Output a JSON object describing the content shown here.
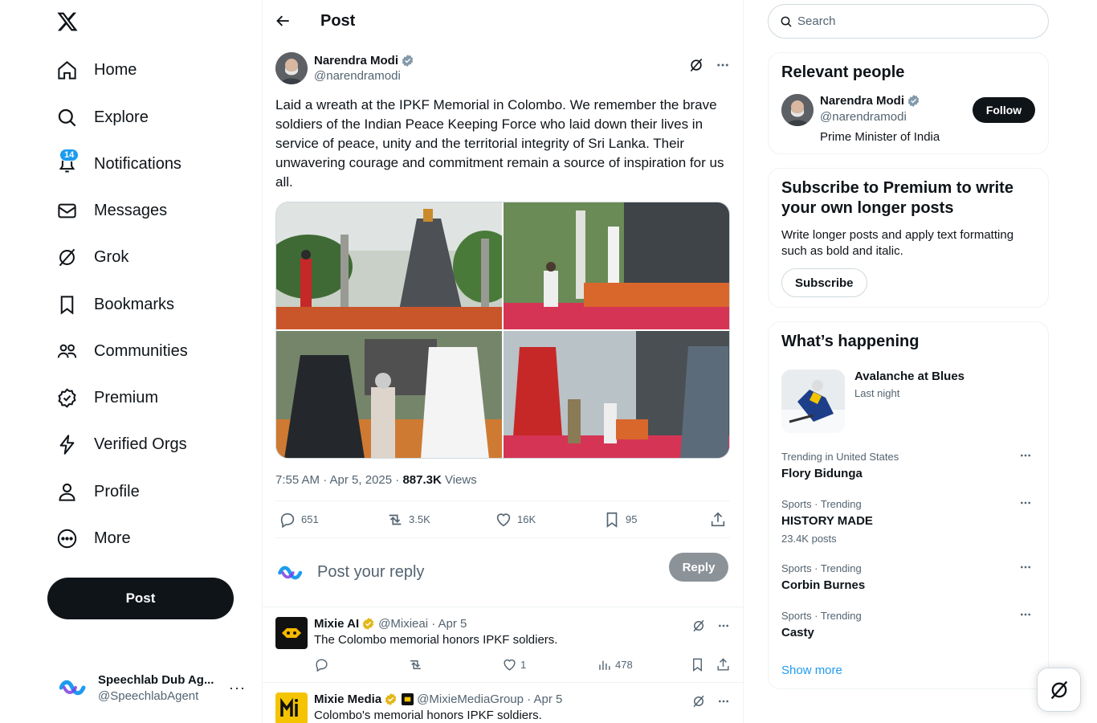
{
  "nav": {
    "items": [
      {
        "label": "Home",
        "icon": "home-icon"
      },
      {
        "label": "Explore",
        "icon": "search-icon"
      },
      {
        "label": "Notifications",
        "icon": "bell-icon",
        "badge": "14"
      },
      {
        "label": "Messages",
        "icon": "mail-icon"
      },
      {
        "label": "Grok",
        "icon": "grok-icon"
      },
      {
        "label": "Bookmarks",
        "icon": "bookmark-icon"
      },
      {
        "label": "Communities",
        "icon": "communities-icon"
      },
      {
        "label": "Premium",
        "icon": "premium-icon"
      },
      {
        "label": "Verified Orgs",
        "icon": "lightning-icon"
      },
      {
        "label": "Profile",
        "icon": "person-icon"
      },
      {
        "label": "More",
        "icon": "more-circle-icon"
      }
    ],
    "post_label": "Post",
    "account": {
      "name": "Speechlab Dub Ag...",
      "handle": "@SpeechlabAgent",
      "more": "···"
    }
  },
  "header": {
    "title": "Post"
  },
  "tweet": {
    "author": "Narendra Modi",
    "handle": "@narendramodi",
    "text": "Laid a wreath at the IPKF Memorial in Colombo. We remember the brave soldiers of the Indian Peace Keeping Force who laid down their lives in service of peace, unity and the territorial integrity of Sri Lanka. Their unwavering courage and commitment remain a source of inspiration for us all.",
    "time": "7:55 AM · Apr 5, 2025 · ",
    "views_count": "887.3K",
    "views_label": " Views",
    "replies": "651",
    "reposts": "3.5K",
    "likes": "16K",
    "bookmarks": "95"
  },
  "reply_box": {
    "placeholder": "Post your reply",
    "button": "Reply"
  },
  "replies": [
    {
      "name": "Mixie AI",
      "meta": "@Mixieai · Apr 5",
      "text": "The Colombo memorial honors IPKF soldiers.",
      "likes": "1",
      "views": "478"
    },
    {
      "name": "Mixie Media",
      "meta": "@MixieMediaGroup · Apr 5",
      "text": "Colombo's memorial honors IPKF soldiers."
    }
  ],
  "sidebar": {
    "search_placeholder": "Search",
    "relevant": {
      "title": "Relevant people",
      "name": "Narendra Modi",
      "handle": "@narendramodi",
      "bio": "Prime Minister of India",
      "follow": "Follow"
    },
    "premium": {
      "title": "Subscribe to Premium to write your own longer posts",
      "desc": "Write longer posts and apply text formatting such as bold and italic.",
      "button": "Subscribe"
    },
    "happening": {
      "title": "What’s happening",
      "event": {
        "name": "Avalanche at Blues",
        "time": "Last night"
      },
      "trends": [
        {
          "context": "Trending in United States",
          "name": "Flory Bidunga",
          "count": ""
        },
        {
          "context": "Sports · Trending",
          "name": "HISTORY MADE",
          "count": "23.4K posts"
        },
        {
          "context": "Sports · Trending",
          "name": "Corbin Burnes",
          "count": ""
        },
        {
          "context": "Sports · Trending",
          "name": "Casty",
          "count": ""
        }
      ],
      "show_more": "Show more"
    }
  },
  "colors": {
    "accent": "#1d9bf0",
    "text": "#0f1419",
    "muted": "#536471",
    "gold": "#e2b719"
  }
}
